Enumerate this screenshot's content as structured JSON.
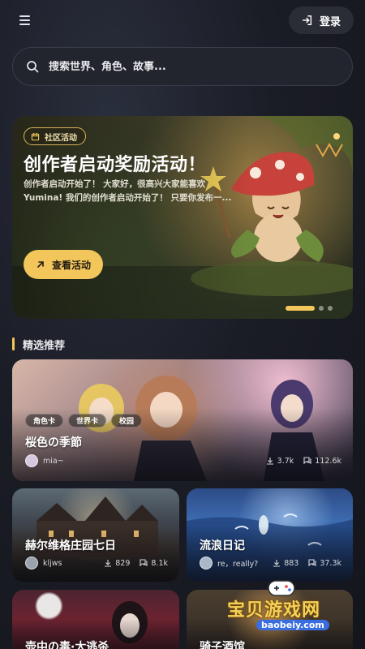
{
  "header": {
    "login_label": "登录"
  },
  "search": {
    "placeholder": "搜索世界、角色、故事..."
  },
  "banner": {
    "tag": "社区活动",
    "title": "创作者启动奖励活动！",
    "description": "创作者启动开始了！ 大家好，很高兴大家能喜欢Yumina! 我们的创作者启动开始了！ 只要你发布一...",
    "button_label": "查看活动",
    "slides_count": 3,
    "active_slide": 1
  },
  "featured": {
    "section_title": "精选推荐",
    "cards": [
      {
        "title": "桜色の季節",
        "chips": [
          "角色卡",
          "世界卡",
          "校园"
        ],
        "author": "mia~",
        "downloads": "3.7k",
        "chats": "112.6k"
      },
      {
        "title": "赫尔维格庄园七日",
        "author": "kljws",
        "downloads": "829",
        "chats": "8.1k"
      },
      {
        "title": "流浪日记",
        "author": "re，really?",
        "downloads": "883",
        "chats": "37.3k"
      },
      {
        "title": "壶中の毒·大逃杀"
      },
      {
        "title": "骑子酒馆"
      }
    ]
  },
  "watermark": {
    "text": "宝贝游戏网",
    "url": "baobeiy.com"
  },
  "colors": {
    "accent": "#f3c65c",
    "background": "#1b1d26"
  }
}
